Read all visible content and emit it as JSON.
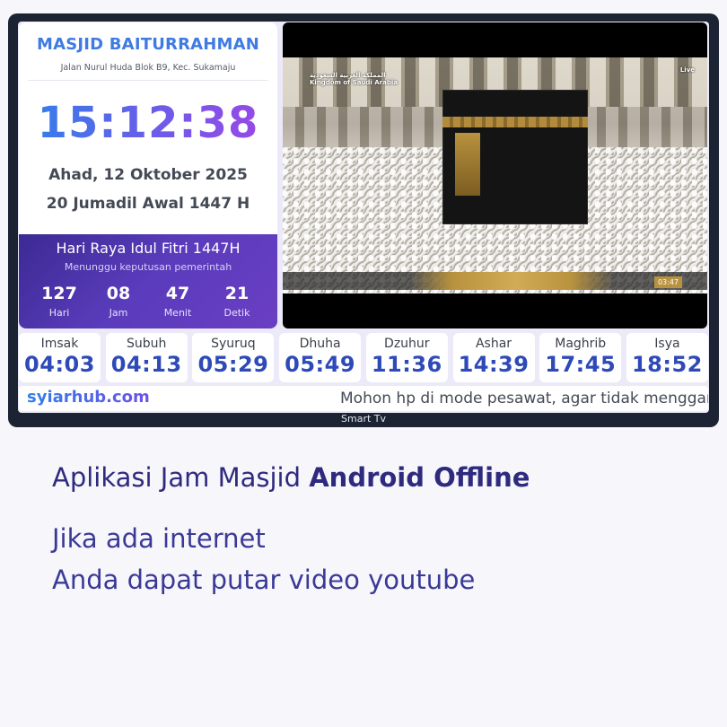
{
  "mosque": {
    "name": "MASJID BAITURRAHMAN",
    "address": "Jalan Nurul Huda Blok B9, Kec. Sukamaju"
  },
  "clock": {
    "time": "15:12:38",
    "date_gregorian": "Ahad, 12 Oktober 2025",
    "date_hijri": "20 Jumadil Awal 1447 H"
  },
  "event": {
    "title": "Hari Raya Idul Fitri 1447H",
    "subtitle": "Menunggu keputusan pemerintah",
    "countdown": [
      {
        "value": "127",
        "label": "Hari"
      },
      {
        "value": "08",
        "label": "Jam"
      },
      {
        "value": "47",
        "label": "Menit"
      },
      {
        "value": "21",
        "label": "Detik"
      }
    ]
  },
  "video": {
    "channel_logo_ar": "المملكة العربية السعودية",
    "channel_logo_en": "Kingdom of Saudi Arabia",
    "live_badge": "Live",
    "timer": "03:47"
  },
  "prayers": [
    {
      "name": "Imsak",
      "time": "04:03"
    },
    {
      "name": "Subuh",
      "time": "04:13"
    },
    {
      "name": "Syuruq",
      "time": "05:29"
    },
    {
      "name": "Dhuha",
      "time": "05:49"
    },
    {
      "name": "Dzuhur",
      "time": "11:36"
    },
    {
      "name": "Ashar",
      "time": "14:39"
    },
    {
      "name": "Maghrib",
      "time": "17:45"
    },
    {
      "name": "Isya",
      "time": "18:52"
    }
  ],
  "footer": {
    "brand": "syiarhub.com",
    "ticker": "Mohon hp di mode pesawat, agar tidak mengganggu"
  },
  "tv_label": "Smart Tv",
  "headline": {
    "part1": "Aplikasi Jam Masjid ",
    "part2": "Android Offline"
  },
  "body": {
    "line1": "Jika ada internet",
    "line2": "Anda dapat putar video youtube"
  },
  "colors": {
    "accent_blue": "#2f80ea",
    "accent_purple": "#6b3ec2",
    "prayer_time": "#2e4ab8",
    "headline": "#2e2a7e"
  }
}
